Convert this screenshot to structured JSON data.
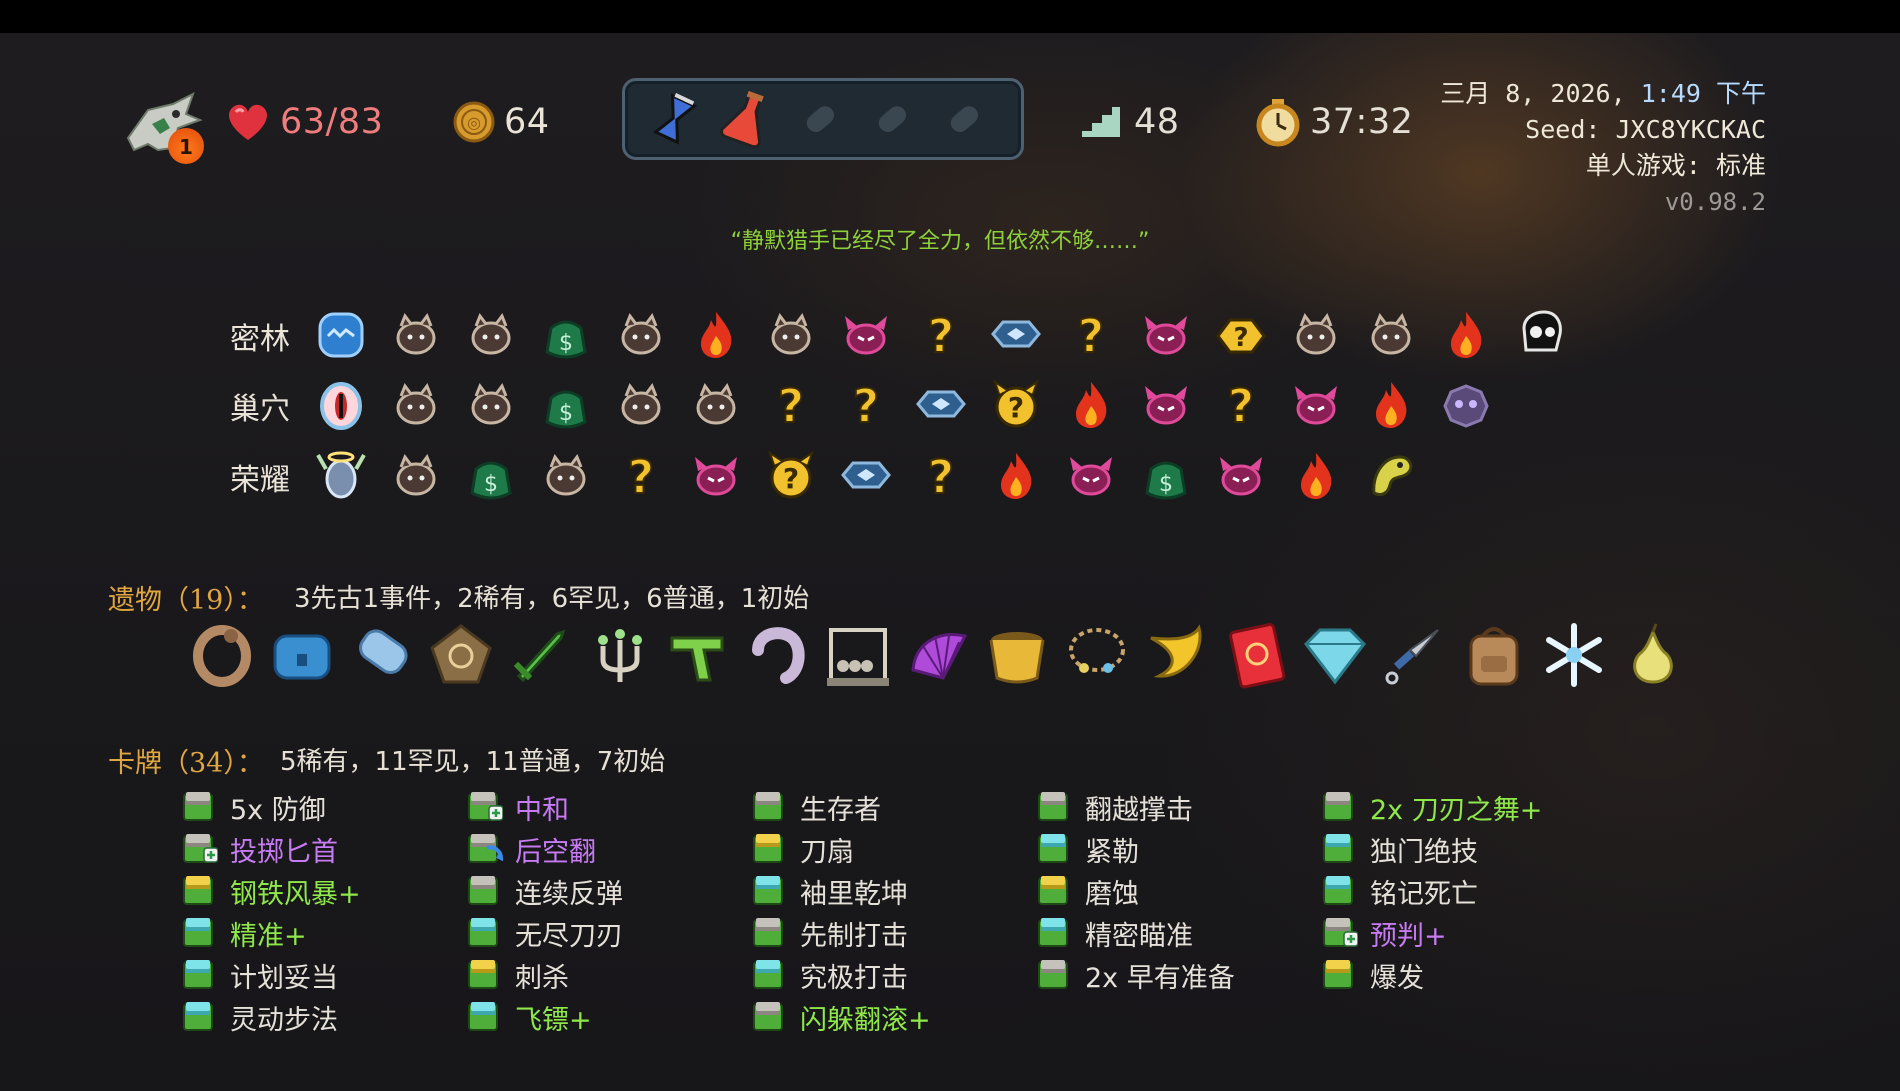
{
  "hud": {
    "ascension_level": "1",
    "hp": "63/83",
    "gold": "64",
    "floor": "48",
    "time": "37:32",
    "potions": [
      "hourglass-potion",
      "red-flask-potion",
      "empty-slot",
      "empty-slot",
      "empty-slot"
    ]
  },
  "info": {
    "date_prefix": "三月 8, 2026,",
    "time": "1:49 下午",
    "seed": "Seed: JXC8YKCKAC",
    "mode": "单人游戏: 标准",
    "version": "v0.98.2"
  },
  "quote": "“静默猎手已经尽了全力，但依然不够……”",
  "map": {
    "acts": [
      {
        "label": "密林",
        "nodes": [
          "boss-blue-slime",
          "monster",
          "monster",
          "merchant",
          "monster",
          "rest-site",
          "monster",
          "elite",
          "unknown",
          "treasure",
          "unknown",
          "elite",
          "unknown-ancient",
          "monster",
          "monster",
          "rest-site",
          "boss-skull"
        ]
      },
      {
        "label": "巢穴",
        "nodes": [
          "boss-eye",
          "monster",
          "monster",
          "merchant",
          "monster",
          "monster",
          "unknown",
          "unknown",
          "treasure",
          "unknown-event",
          "rest-site",
          "elite",
          "unknown",
          "elite",
          "rest-site",
          "boss-purple"
        ]
      },
      {
        "label": "荣耀",
        "nodes": [
          "boss-angel",
          "monster",
          "merchant",
          "monster",
          "unknown",
          "elite",
          "unknown-event",
          "treasure",
          "unknown",
          "rest-site",
          "elite",
          "merchant",
          "elite",
          "rest-site",
          "boss-worm"
        ]
      }
    ]
  },
  "relics": {
    "title": "遗物（19）：",
    "summary": "3先古1事件，2稀有，6罕见，6普通，1初始",
    "items": [
      "ring-of-snake",
      "treasure-chest",
      "sleeping-bag",
      "pentagon-shield",
      "green-sword",
      "candelabra",
      "green-gun",
      "curved-horn",
      "newtons-cradle",
      "purple-fan",
      "golden-bucket",
      "charm-bracelet",
      "banana",
      "red-book",
      "crystal-gem",
      "kunai",
      "backpack",
      "snowflake",
      "pear"
    ]
  },
  "cards": {
    "title": "卡牌（34）：",
    "summary": "5稀有，11罕见，11普通，7初始",
    "columns": [
      [
        {
          "name": "5x 防御",
          "style": "normal",
          "icon": "grey"
        },
        {
          "name": "投掷匕首",
          "style": "pink",
          "icon": "grey-plus"
        },
        {
          "name": "钢铁风暴+",
          "style": "up",
          "icon": "yellow"
        },
        {
          "name": "精准+",
          "style": "up",
          "icon": "cyan"
        },
        {
          "name": "计划妥当",
          "style": "normal",
          "icon": "cyan"
        },
        {
          "name": "灵动步法",
          "style": "normal",
          "icon": "cyan"
        }
      ],
      [
        {
          "name": "中和",
          "style": "pink",
          "icon": "grey-plus"
        },
        {
          "name": "后空翻",
          "style": "pink",
          "icon": "grey-flip"
        },
        {
          "name": "连续反弹",
          "style": "normal",
          "icon": "grey"
        },
        {
          "name": "无尽刀刃",
          "style": "normal",
          "icon": "cyan"
        },
        {
          "name": "刺杀",
          "style": "normal",
          "icon": "yellow"
        },
        {
          "name": "飞镖+",
          "style": "up",
          "icon": "cyan"
        }
      ],
      [
        {
          "name": "生存者",
          "style": "normal",
          "icon": "grey"
        },
        {
          "name": "刀扇",
          "style": "normal",
          "icon": "yellow"
        },
        {
          "name": "袖里乾坤",
          "style": "normal",
          "icon": "cyan"
        },
        {
          "name": "先制打击",
          "style": "normal",
          "icon": "grey"
        },
        {
          "name": "究极打击",
          "style": "normal",
          "icon": "cyan"
        },
        {
          "name": "闪躲翻滚+",
          "style": "up",
          "icon": "grey"
        }
      ],
      [
        {
          "name": "翻越撑击",
          "style": "normal",
          "icon": "grey"
        },
        {
          "name": "紧勒",
          "style": "normal",
          "icon": "cyan"
        },
        {
          "name": "磨蚀",
          "style": "normal",
          "icon": "yellow"
        },
        {
          "name": "精密瞄准",
          "style": "normal",
          "icon": "cyan"
        },
        {
          "name": "2x 早有准备",
          "style": "normal",
          "icon": "grey"
        }
      ],
      [
        {
          "name": "2x 刀刃之舞+",
          "style": "up",
          "icon": "grey"
        },
        {
          "name": "独门绝技",
          "style": "normal",
          "icon": "cyan"
        },
        {
          "name": "铭记死亡",
          "style": "normal",
          "icon": "cyan"
        },
        {
          "name": "预判+",
          "style": "pink",
          "icon": "grey-plus"
        },
        {
          "name": "爆发",
          "style": "normal",
          "icon": "yellow"
        }
      ]
    ]
  },
  "colors": {
    "hp": "#f07d7d",
    "quote": "#8ed13a",
    "section_title": "#e0a640",
    "upgraded": "#8ee84a",
    "special": "#c77bf3",
    "datetime": "#b7dbff"
  }
}
